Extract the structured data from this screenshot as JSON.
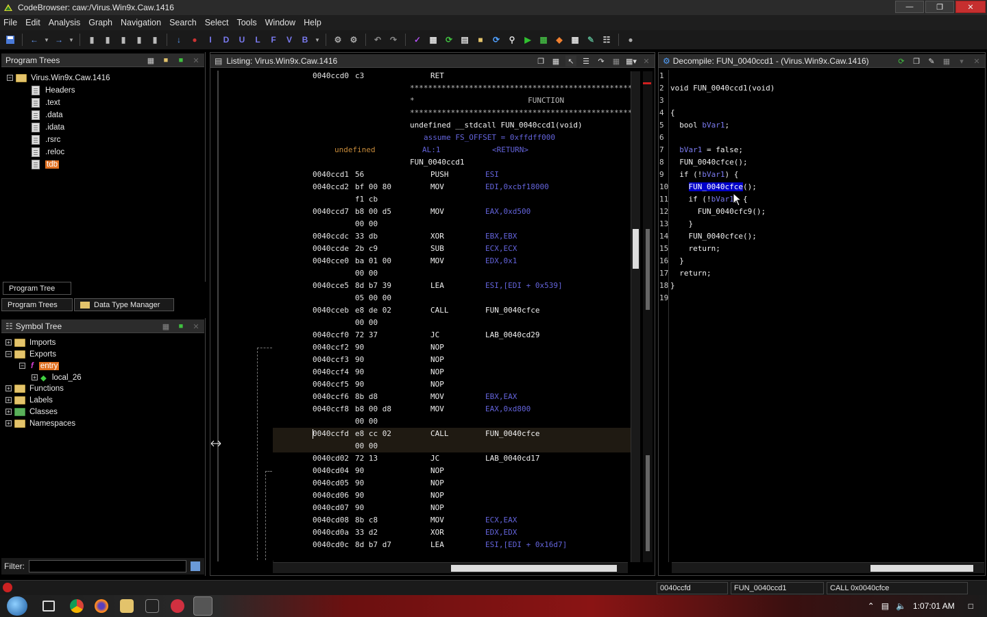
{
  "window": {
    "title": "CodeBrowser: caw:/Virus.Win9x.Caw.1416"
  },
  "menu": [
    "File",
    "Edit",
    "Analysis",
    "Graph",
    "Navigation",
    "Search",
    "Select",
    "Tools",
    "Window",
    "Help"
  ],
  "toolbar": {
    "letters": [
      "I",
      "D",
      "U",
      "L",
      "F",
      "V",
      "B"
    ]
  },
  "program_trees": {
    "title": "Program Trees",
    "root": "Virus.Win9x.Caw.1416",
    "items": [
      "Headers",
      ".text",
      ".data",
      ".idata",
      ".rsrc",
      ".reloc",
      "tdb"
    ],
    "tab_active": "Program Tree",
    "bottom_tabs": [
      "Program Trees",
      "Data Type Manager"
    ]
  },
  "symbol_tree": {
    "title": "Symbol Tree",
    "items": [
      "Imports",
      "Exports",
      "entry",
      "local_26",
      "Functions",
      "Labels",
      "Classes",
      "Namespaces"
    ],
    "filter_label": "Filter:",
    "filter_value": ""
  },
  "listing": {
    "title": "Listing:  Virus.Win9x.Caw.1416",
    "lines": [
      {
        "addr": "0040ccd0",
        "bytes": "c3",
        "mn": "RET",
        "op": ""
      },
      {
        "stars": "**************************************************************"
      },
      {
        "star_func": "*                         FUNCTION"
      },
      {
        "stars": "**************************************************************"
      },
      {
        "sig": "undefined __stdcall FUN_0040ccd1(void)"
      },
      {
        "assume": "assume FS_OFFSET = 0xffdff000"
      },
      {
        "undef": "undefined",
        "ret": "AL:1",
        "retlbl": "<RETURN>"
      },
      {
        "label": "FUN_0040ccd1"
      },
      {
        "addr": "0040ccd1",
        "bytes": "56",
        "mn": "PUSH",
        "op": "ESI"
      },
      {
        "addr": "0040ccd2",
        "bytes": "bf 00 80",
        "mn": "MOV",
        "op": "EDI,0xcbf18000"
      },
      {
        "addr": "",
        "bytes": "f1 cb",
        "mn": "",
        "op": ""
      },
      {
        "addr": "0040ccd7",
        "bytes": "b8 00 d5",
        "mn": "MOV",
        "op": "EAX,0xd500"
      },
      {
        "addr": "",
        "bytes": "00 00",
        "mn": "",
        "op": ""
      },
      {
        "addr": "0040ccdc",
        "bytes": "33 db",
        "mn": "XOR",
        "op": "EBX,EBX"
      },
      {
        "addr": "0040ccde",
        "bytes": "2b c9",
        "mn": "SUB",
        "op": "ECX,ECX"
      },
      {
        "addr": "0040cce0",
        "bytes": "ba 01 00",
        "mn": "MOV",
        "op": "EDX,0x1"
      },
      {
        "addr": "",
        "bytes": "00 00",
        "mn": "",
        "op": ""
      },
      {
        "addr": "0040cce5",
        "bytes": "8d b7 39",
        "mn": "LEA",
        "op": "ESI,[EDI + 0x539]"
      },
      {
        "addr": "",
        "bytes": "05 00 00",
        "mn": "",
        "op": ""
      },
      {
        "addr": "0040cceb",
        "bytes": "e8 de 02",
        "mn": "CALL",
        "op": "FUN_0040cfce"
      },
      {
        "addr": "",
        "bytes": "00 00",
        "mn": "",
        "op": ""
      },
      {
        "addr": "0040ccf0",
        "bytes": "72 37",
        "mn": "JC",
        "op": "LAB_0040cd29"
      },
      {
        "addr": "0040ccf2",
        "bytes": "90",
        "mn": "NOP",
        "op": ""
      },
      {
        "addr": "0040ccf3",
        "bytes": "90",
        "mn": "NOP",
        "op": ""
      },
      {
        "addr": "0040ccf4",
        "bytes": "90",
        "mn": "NOP",
        "op": ""
      },
      {
        "addr": "0040ccf5",
        "bytes": "90",
        "mn": "NOP",
        "op": ""
      },
      {
        "addr": "0040ccf6",
        "bytes": "8b d8",
        "mn": "MOV",
        "op": "EBX,EAX"
      },
      {
        "addr": "0040ccf8",
        "bytes": "b8 00 d8",
        "mn": "MOV",
        "op": "EAX,0xd800"
      },
      {
        "addr": "",
        "bytes": "00 00",
        "mn": "",
        "op": ""
      },
      {
        "addr": "0040ccfd",
        "bytes": "e8 cc 02",
        "mn": "CALL",
        "op": "FUN_0040cfce",
        "highlight": true
      },
      {
        "addr": "",
        "bytes": "00 00",
        "mn": "",
        "op": "",
        "highlight": true
      },
      {
        "addr": "0040cd02",
        "bytes": "72 13",
        "mn": "JC",
        "op": "LAB_0040cd17"
      },
      {
        "addr": "0040cd04",
        "bytes": "90",
        "mn": "NOP",
        "op": ""
      },
      {
        "addr": "0040cd05",
        "bytes": "90",
        "mn": "NOP",
        "op": ""
      },
      {
        "addr": "0040cd06",
        "bytes": "90",
        "mn": "NOP",
        "op": ""
      },
      {
        "addr": "0040cd07",
        "bytes": "90",
        "mn": "NOP",
        "op": ""
      },
      {
        "addr": "0040cd08",
        "bytes": "8b c8",
        "mn": "MOV",
        "op": "ECX,EAX"
      },
      {
        "addr": "0040cd0a",
        "bytes": "33 d2",
        "mn": "XOR",
        "op": "EDX,EDX"
      },
      {
        "addr": "0040cd0c",
        "bytes": "8d b7 d7",
        "mn": "LEA",
        "op": "ESI,[EDI + 0x16d7]"
      }
    ]
  },
  "decompile": {
    "title": "Decompile: FUN_0040ccd1 - (Virus.Win9x.Caw.1416)",
    "lines": [
      "",
      "void FUN_0040ccd1(void)",
      "",
      "{",
      "  bool bVar1;",
      "",
      "  bVar1 = false;",
      "  FUN_0040cfce();",
      "  if (!bVar1) {",
      "    FUN_0040cfce();",
      "    if (!bVar1) {",
      "      FUN_0040cfc9();",
      "    }",
      "    FUN_0040cfce();",
      "    return;",
      "  }",
      "  return;",
      "}",
      ""
    ],
    "line_numbers": [
      "1",
      "2",
      "3",
      "4",
      "5",
      "6",
      "7",
      "8",
      "9",
      "10",
      "11",
      "12",
      "13",
      "14",
      "15",
      "16",
      "17",
      "18",
      "19"
    ]
  },
  "status": {
    "address": "0040ccfd",
    "function": "FUN_0040ccd1",
    "instruction": "CALL 0x0040cfce"
  },
  "taskbar": {
    "time": "1:07:01 AM"
  },
  "colors": {
    "register": "#6464dc",
    "highlight_row": "#1f1a12",
    "selection": "#0000c8"
  }
}
